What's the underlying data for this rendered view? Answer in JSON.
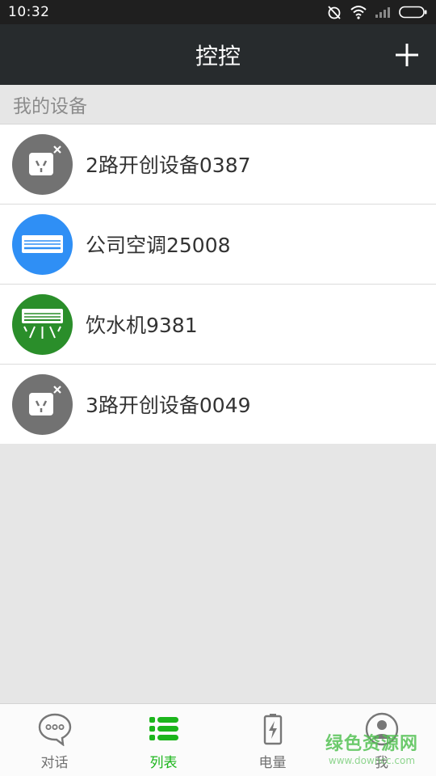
{
  "status_bar": {
    "time": "10:32"
  },
  "header": {
    "title": "控控"
  },
  "section": {
    "title": "我的设备"
  },
  "devices": [
    {
      "name": "2路开创设备0387",
      "icon": "socket-offline-icon",
      "color": "#727272"
    },
    {
      "name": "公司空调25008",
      "icon": "air-conditioner-icon",
      "color": "#2f8ff5"
    },
    {
      "name": "饮水机9381",
      "icon": "air-conditioner-cool-icon",
      "color": "#2a8e2a"
    },
    {
      "name": "3路开创设备0049",
      "icon": "socket-offline-icon",
      "color": "#727272"
    }
  ],
  "tabs": [
    {
      "label": "对话",
      "icon": "chat-bubble-icon",
      "active": false
    },
    {
      "label": "列表",
      "icon": "list-icon",
      "active": true
    },
    {
      "label": "电量",
      "icon": "battery-icon",
      "active": false
    },
    {
      "label": "我",
      "icon": "profile-icon",
      "active": false
    }
  ],
  "watermark": {
    "text": "绿色资源网",
    "url": "www.downcc.com"
  },
  "colors": {
    "active_tab": "#1cb51c",
    "title_bar": "#272b2d"
  }
}
